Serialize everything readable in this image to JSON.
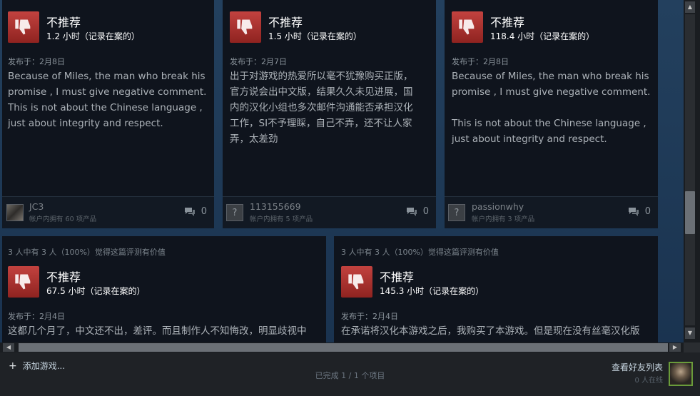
{
  "reviews_row1": [
    {
      "verdict": "不推荐",
      "hours": "1.2 小时（记录在案的）",
      "posted": "发布于：2月8日",
      "content": "Because of Miles, the man who break his\npromise , I must give negative comment.\nThis is not about the Chinese language ,\njust about integrity and respect.",
      "author": "JC3",
      "owned": "帐户内拥有 60 项产品",
      "comments": "0",
      "avatar_glyph": ""
    },
    {
      "verdict": "不推荐",
      "hours": "1.5 小时（记录在案的）",
      "posted": "发布于：2月7日",
      "content": "出于对游戏的热爱所以毫不犹豫购买正版，\n官方说会出中文版，结果久久未见进展，国\n内的汉化小组也多次邮件沟通能否承担汉化\n工作，SI不予理睬，自己不弄，还不让人家\n弄，太差劲",
      "author": "113155669",
      "owned": "帐户内拥有 5 项产品",
      "comments": "0",
      "avatar_glyph": "?"
    },
    {
      "verdict": "不推荐",
      "hours": "118.4 小时（记录在案的）",
      "posted": "发布于：2月8日",
      "content": "Because of Miles, the man who break his\npromise , I must give negative comment.\n\nThis is not about the Chinese language ,\njust about integrity and respect.",
      "author": "passionwhy",
      "owned": "帐户内拥有 3 项产品",
      "comments": "0",
      "avatar_glyph": "?"
    }
  ],
  "reviews_row2": [
    {
      "helpful": "3 人中有 3 人（100%）觉得这篇评测有价值",
      "verdict": "不推荐",
      "hours": "67.5 小时（记录在案的）",
      "posted": "发布于：2月4日",
      "content": "这都几个月了，中文还不出，差评。而且制作人不知悔改，明显歧视中"
    },
    {
      "helpful": "3 人中有 3 人（100%）觉得这篇评测有价值",
      "verdict": "不推荐",
      "hours": "145.3 小时（记录在案的）",
      "posted": "发布于：2月4日",
      "content": "在承诺将汉化本游戏之后，我购买了本游戏。但是现在没有丝毫汉化版"
    }
  ],
  "bottombar": {
    "add_games": "添加游戏...",
    "status": "已完成 1 / 1 个项目",
    "friends_list": "查看好友列表",
    "online": "0 人在线"
  },
  "colors": {
    "thumbs_down": "#c2423f",
    "card_bg": "#0f141d",
    "friend_border": "#6a9b3a"
  },
  "icons": {
    "thumbs_down": "thumbs-down-icon",
    "comment": "comment-icon",
    "plus": "plus-icon"
  }
}
